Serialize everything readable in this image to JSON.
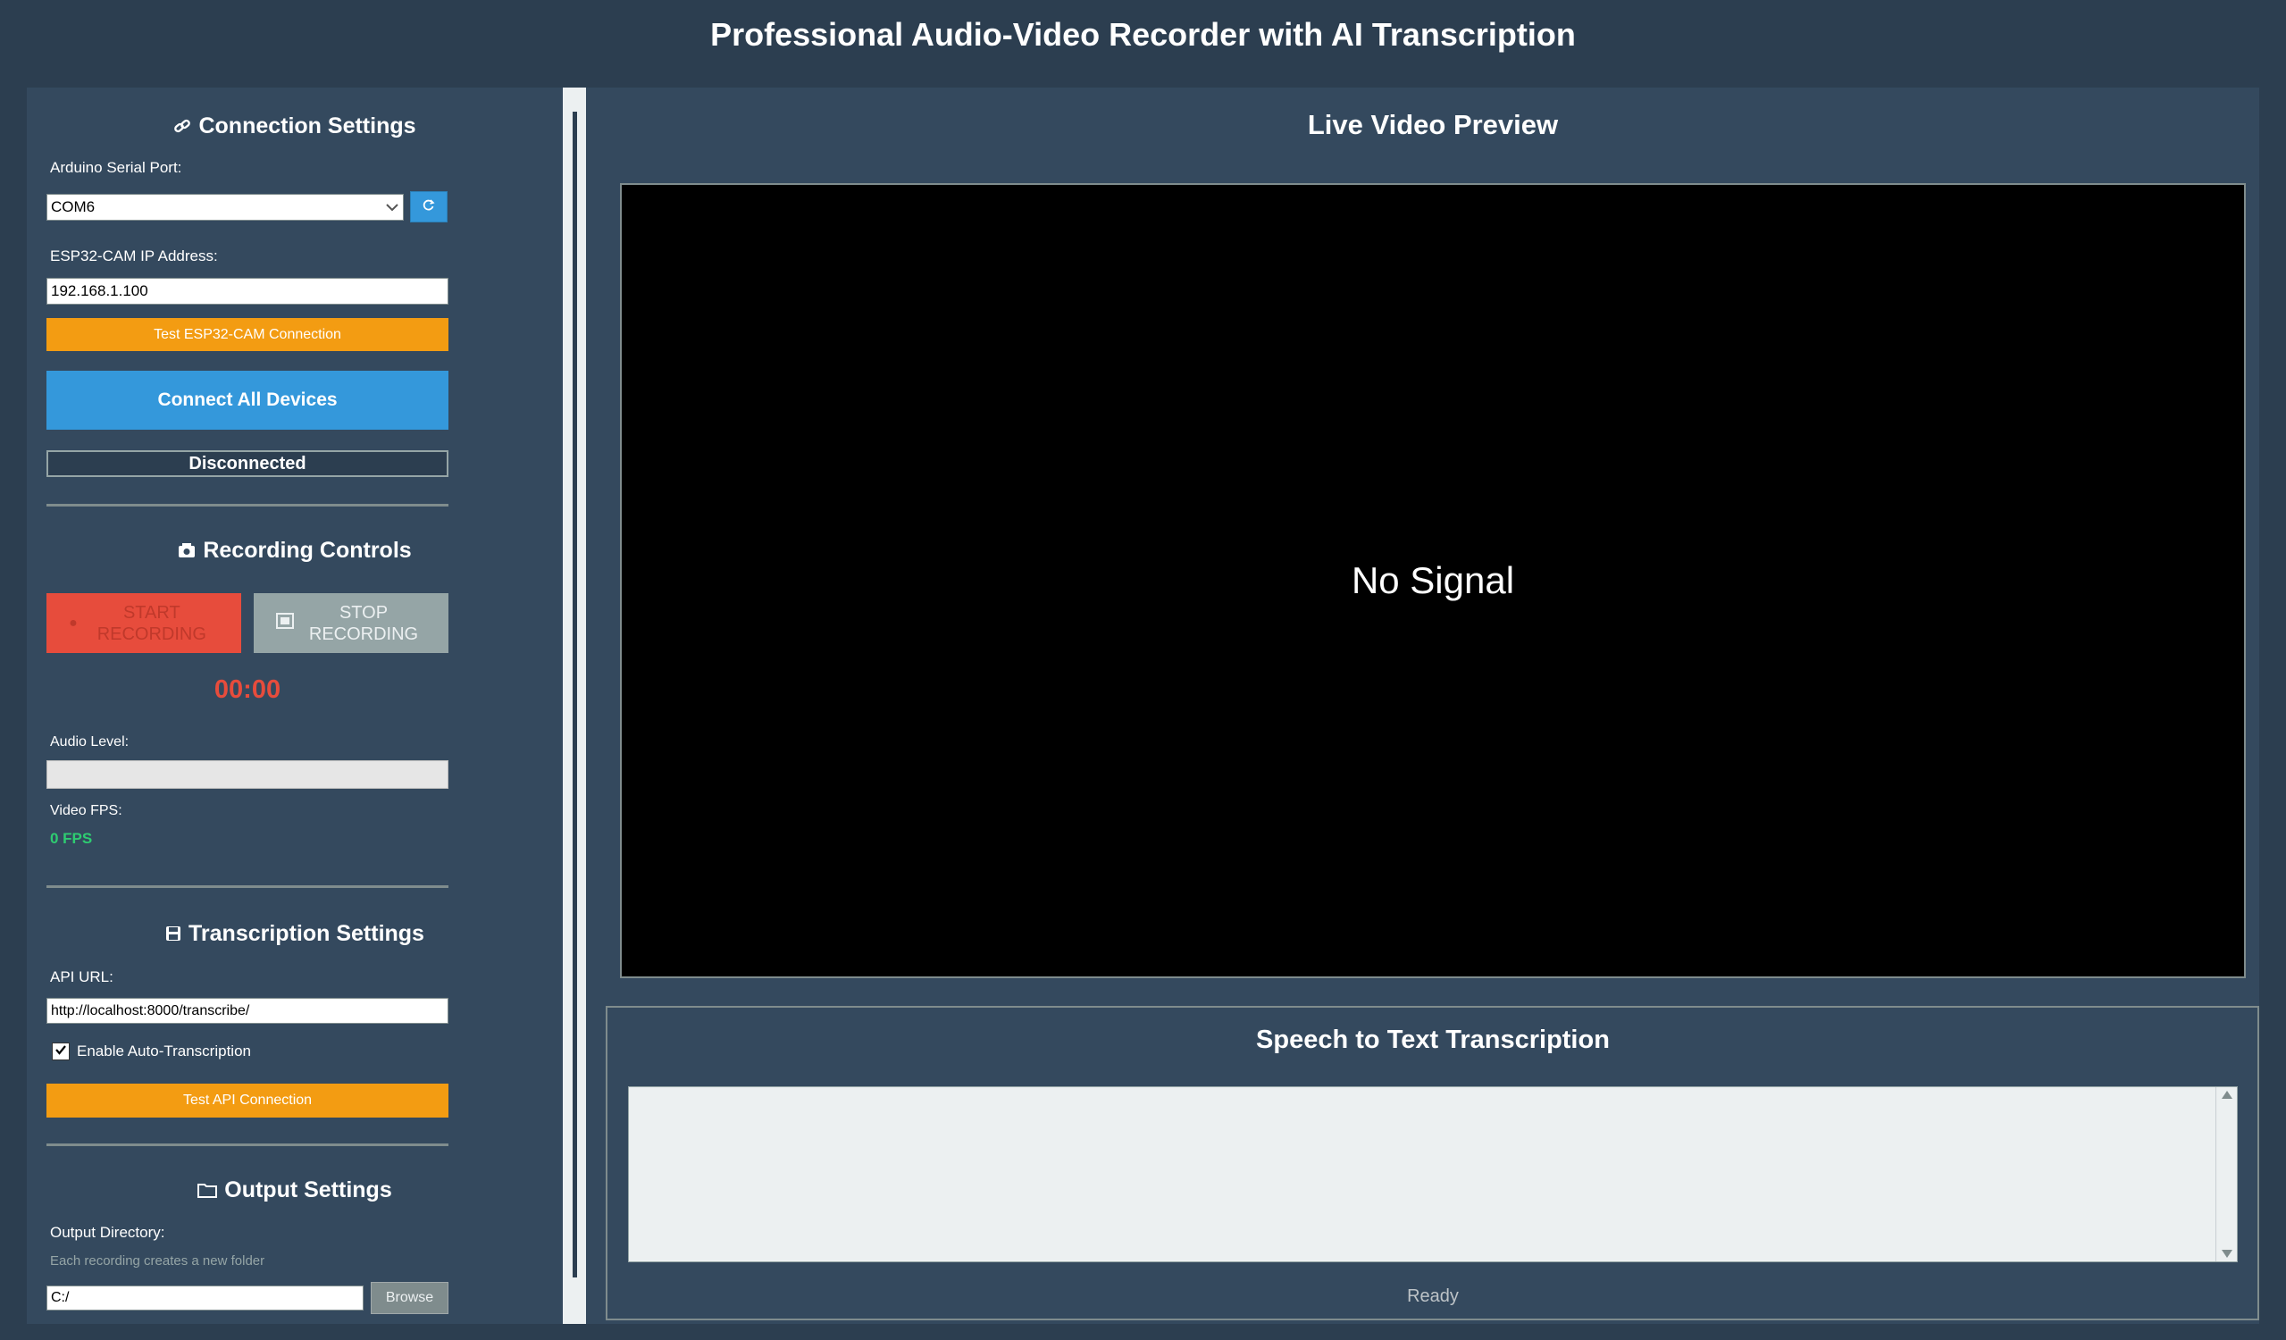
{
  "window": {
    "title": "Professional Audio-Video Recorder with AI Transcription"
  },
  "connection": {
    "title": "Connection Settings",
    "icon": "link-icon",
    "serial_port_label": "Arduino Serial Port:",
    "serial_port_value": "COM6",
    "refresh_icon": "refresh-icon",
    "esp_ip_label": "ESP32-CAM IP Address:",
    "esp_ip_value": "192.168.1.100",
    "test_esp_label": "Test ESP32-CAM Connection",
    "connect_label": "Connect All Devices",
    "status": "Disconnected"
  },
  "recording": {
    "title": "Recording Controls",
    "icon": "video-camera-icon",
    "start_symbol": "●",
    "start_label": "START RECORDING",
    "stop_label": "STOP RECORDING",
    "timer": "00:00",
    "audio_level_label": "Audio Level:",
    "audio_level": 0,
    "fps_label": "Video FPS:",
    "fps_value": "0 FPS"
  },
  "transcription_settings": {
    "title": "Transcription Settings",
    "icon": "save-icon",
    "api_url_label": "API URL:",
    "api_url_value": "http://localhost:8000/transcribe/",
    "auto_label": "Enable Auto-Transcription",
    "auto_checked": true,
    "test_api_label": "Test API Connection"
  },
  "output": {
    "title": "Output Settings",
    "icon": "folder-icon",
    "dir_label": "Output Directory:",
    "hint": "Each recording creates a new folder",
    "dir_value": "C:/",
    "browse_label": "Browse"
  },
  "preview": {
    "title": "Live Video Preview",
    "placeholder": "No Signal"
  },
  "transcription": {
    "title": "Speech to Text Transcription",
    "text": "",
    "status": "Ready"
  },
  "colors": {
    "background": "#2c3e50",
    "panel": "#34495e",
    "accent_blue": "#3498db",
    "accent_orange": "#f39c12",
    "record_red": "#e74c3c",
    "stop_gray": "#95a5a6",
    "timer_red": "#e74c3c",
    "fps_green": "#2ecc71"
  }
}
